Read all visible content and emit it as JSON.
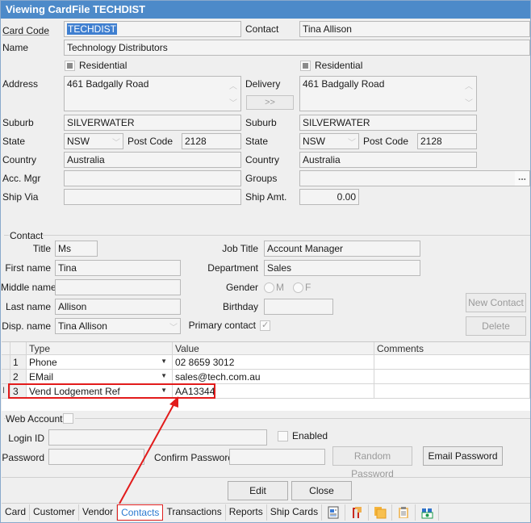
{
  "window": {
    "title": "Viewing CardFile TECHDIST"
  },
  "card": {
    "card_code_label": "Card Code",
    "card_code": "TECHDIST",
    "contact_label": "Contact",
    "contact": "Tina Allison",
    "name_label": "Name",
    "name": "Technology Distributors",
    "residential_label": "Residential",
    "address_label": "Address",
    "address": "461 Badgally Road",
    "delivery_label": "Delivery",
    "delivery": "461 Badgally Road",
    "copy_button": ">>",
    "suburb_label": "Suburb",
    "suburb": "SILVERWATER",
    "delivery_suburb": "SILVERWATER",
    "state_label": "State",
    "state": "NSW",
    "delivery_state": "NSW",
    "post_code_label": "Post Code",
    "post_code": "2128",
    "delivery_post_code": "2128",
    "country_label": "Country",
    "country": "Australia",
    "delivery_country": "Australia",
    "acc_mgr_label": "Acc. Mgr",
    "acc_mgr": "",
    "groups_label": "Groups",
    "groups": "",
    "groups_button": "...",
    "ship_via_label": "Ship Via",
    "ship_via": "",
    "ship_amt_label": "Ship Amt.",
    "ship_amt": "0.00"
  },
  "contact": {
    "group_label": "Contact",
    "title_label": "Title",
    "title": "Ms",
    "first_name_label": "First name",
    "first_name": "Tina",
    "middle_name_label": "Middle name",
    "middle_name": "",
    "last_name_label": "Last name",
    "last_name": "Allison",
    "disp_name_label": "Disp. name",
    "disp_name": "Tina Allison",
    "job_title_label": "Job Title",
    "job_title": "Account Manager",
    "department_label": "Department",
    "department": "Sales",
    "gender_label": "Gender",
    "gender_m": "M",
    "gender_f": "F",
    "birthday_label": "Birthday",
    "birthday": "",
    "primary_contact_label": "Primary contact",
    "primary_contact_checked": true,
    "new_contact_button": "New Contact",
    "delete_button": "Delete"
  },
  "grid": {
    "columns": [
      "Type",
      "Value",
      "Comments"
    ],
    "rows": [
      {
        "num": "1",
        "type": "Phone",
        "value": "02 8659 3012",
        "comments": ""
      },
      {
        "num": "2",
        "type": "EMail",
        "value": "sales@tech.com.au",
        "comments": ""
      },
      {
        "num": "3",
        "type": "Vend Lodgement Ref",
        "value": "AA13344",
        "comments": ""
      }
    ]
  },
  "web": {
    "web_account_label": "Web Account",
    "login_id_label": "Login ID",
    "login_id": "",
    "enabled_label": "Enabled",
    "password_label": "Password",
    "password": "",
    "confirm_password_label": "Confirm Password",
    "confirm_password": "",
    "random_password_button": "Random Password",
    "email_password_button": "Email Password"
  },
  "footer": {
    "edit_button": "Edit",
    "close_button": "Close"
  },
  "tabs": [
    {
      "label": "Card"
    },
    {
      "label": "Customer"
    },
    {
      "label": "Vendor"
    },
    {
      "label": "Contacts",
      "active": true
    },
    {
      "label": "Transactions"
    },
    {
      "label": "Reports"
    },
    {
      "label": "Ship Cards"
    }
  ],
  "tab_icons": [
    "document-icon",
    "book-icon",
    "copy-pages-icon",
    "clipboard-icon",
    "gift-money-icon"
  ],
  "annotation": {
    "color": "#e21b1b"
  }
}
